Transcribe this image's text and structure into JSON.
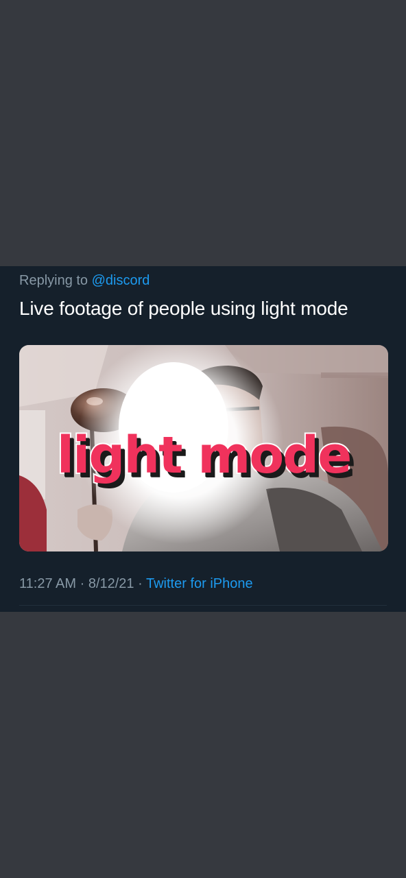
{
  "tweet": {
    "reply_prefix": "Replying to",
    "reply_handle": "@discord",
    "text": "Live footage of people using light mode",
    "media": {
      "icon": "photo-image",
      "caption": "light mode"
    },
    "time": "11:27 AM",
    "separator": "·",
    "date": "8/12/21",
    "source": "Twitter for iPhone"
  },
  "colors": {
    "page_background": "#36393f",
    "card_background": "#15202b",
    "secondary_text": "#8899a6",
    "link": "#1d9bf0",
    "caption_red": "#f0325c"
  }
}
